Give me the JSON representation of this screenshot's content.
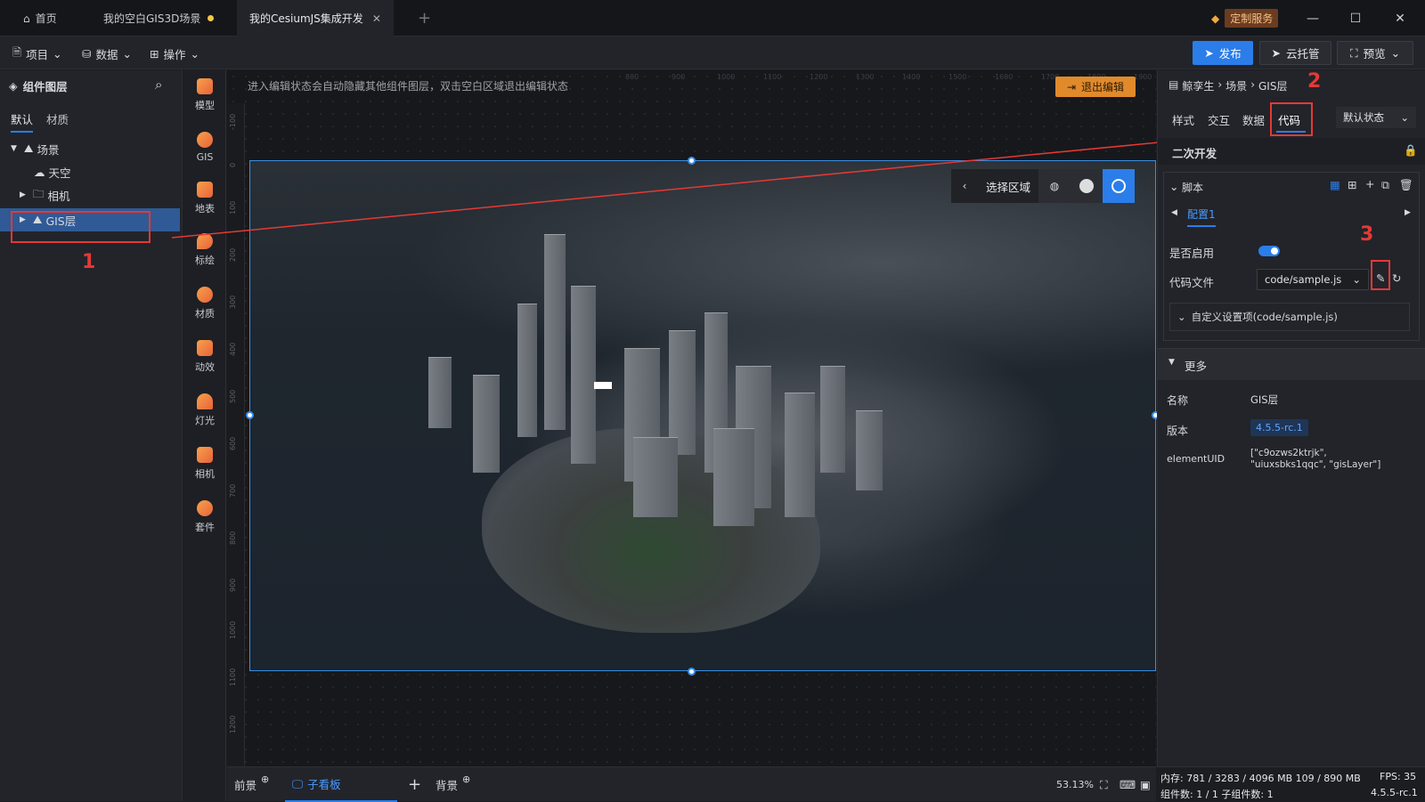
{
  "tabs": [
    {
      "label": "首页",
      "icon": "home-icon"
    },
    {
      "label": "我的空白GIS3D场景",
      "modified": true
    },
    {
      "label": "我的CesiumJS集成开发",
      "active": true
    }
  ],
  "titlebar": {
    "custom_service": "定制服务"
  },
  "toolbar": {
    "menus": [
      "项目",
      "数据",
      "操作"
    ],
    "publish": "发布",
    "cloud": "云托管",
    "preview": "预览"
  },
  "left_panel": {
    "title": "组件图层",
    "tabs": [
      "默认",
      "材质"
    ],
    "tree": [
      {
        "label": "场景",
        "icon": "mountain-icon",
        "level": 0,
        "expanded": true
      },
      {
        "label": "天空",
        "icon": "weather-icon",
        "level": 1
      },
      {
        "label": "相机",
        "icon": "folder-icon",
        "level": 1,
        "collapsed": true
      },
      {
        "label": "GIS层",
        "icon": "gis-layer-icon",
        "level": 1,
        "selected": true
      }
    ]
  },
  "icon_column": [
    "模型",
    "GIS",
    "地表",
    "标绘",
    "材质",
    "动效",
    "灯光",
    "相机",
    "套件"
  ],
  "canvas": {
    "hint": "进入编辑状态会自动隐藏其他组件图层，双击空白区域退出编辑状态",
    "exit_edit": "退出编辑",
    "ruler_top": [
      "800",
      "900",
      "1000",
      "1100",
      "1200",
      "1300",
      "1400",
      "1500",
      "1600",
      "1700",
      "1800",
      "1900"
    ],
    "ruler_left": [
      "-100",
      "0",
      "100",
      "200",
      "300",
      "400",
      "500",
      "600",
      "700",
      "800",
      "900",
      "1000",
      "1100",
      "1200"
    ],
    "map_tool_label": "选择区域"
  },
  "bottom": {
    "foreground": "前景",
    "sub_board": "子看板",
    "background": "背景",
    "zoom": "53.13%"
  },
  "right_panel": {
    "breadcrumb": [
      "鲸孪生",
      "场景",
      "GIS层"
    ],
    "tabs": [
      "样式",
      "交互",
      "数据",
      "代码"
    ],
    "active_tab": "代码",
    "state_select": "默认状态",
    "section_title": "二次开发",
    "script_label": "脚本",
    "config_tab": "配置1",
    "enable_label": "是否启用",
    "enabled": true,
    "code_file_label": "代码文件",
    "code_file_value": "code/sample.js",
    "custom_settings": "自定义设置项(code/sample.js)",
    "more_label": "更多",
    "name_label": "名称",
    "name_value": "GIS层",
    "version_label": "版本",
    "version_value": "4.5.5-rc.1",
    "uid_label": "elementUID",
    "uid_value": "[\"c9ozws2ktrjk\", \"uiuxsbks1qqc\", \"gisLayer\"]"
  },
  "status": {
    "memory": "内存: 781 / 3283 / 4096 MB  109 / 890 MB",
    "fps": "FPS: 35",
    "components": "组件数: 1 / 1   子组件数: 1",
    "version": "4.5.5-rc.1"
  },
  "annotations": [
    "1",
    "2",
    "3"
  ],
  "colors": {
    "accent": "#2b7de9",
    "warning": "#e08a2c",
    "annotation": "#e53935"
  }
}
